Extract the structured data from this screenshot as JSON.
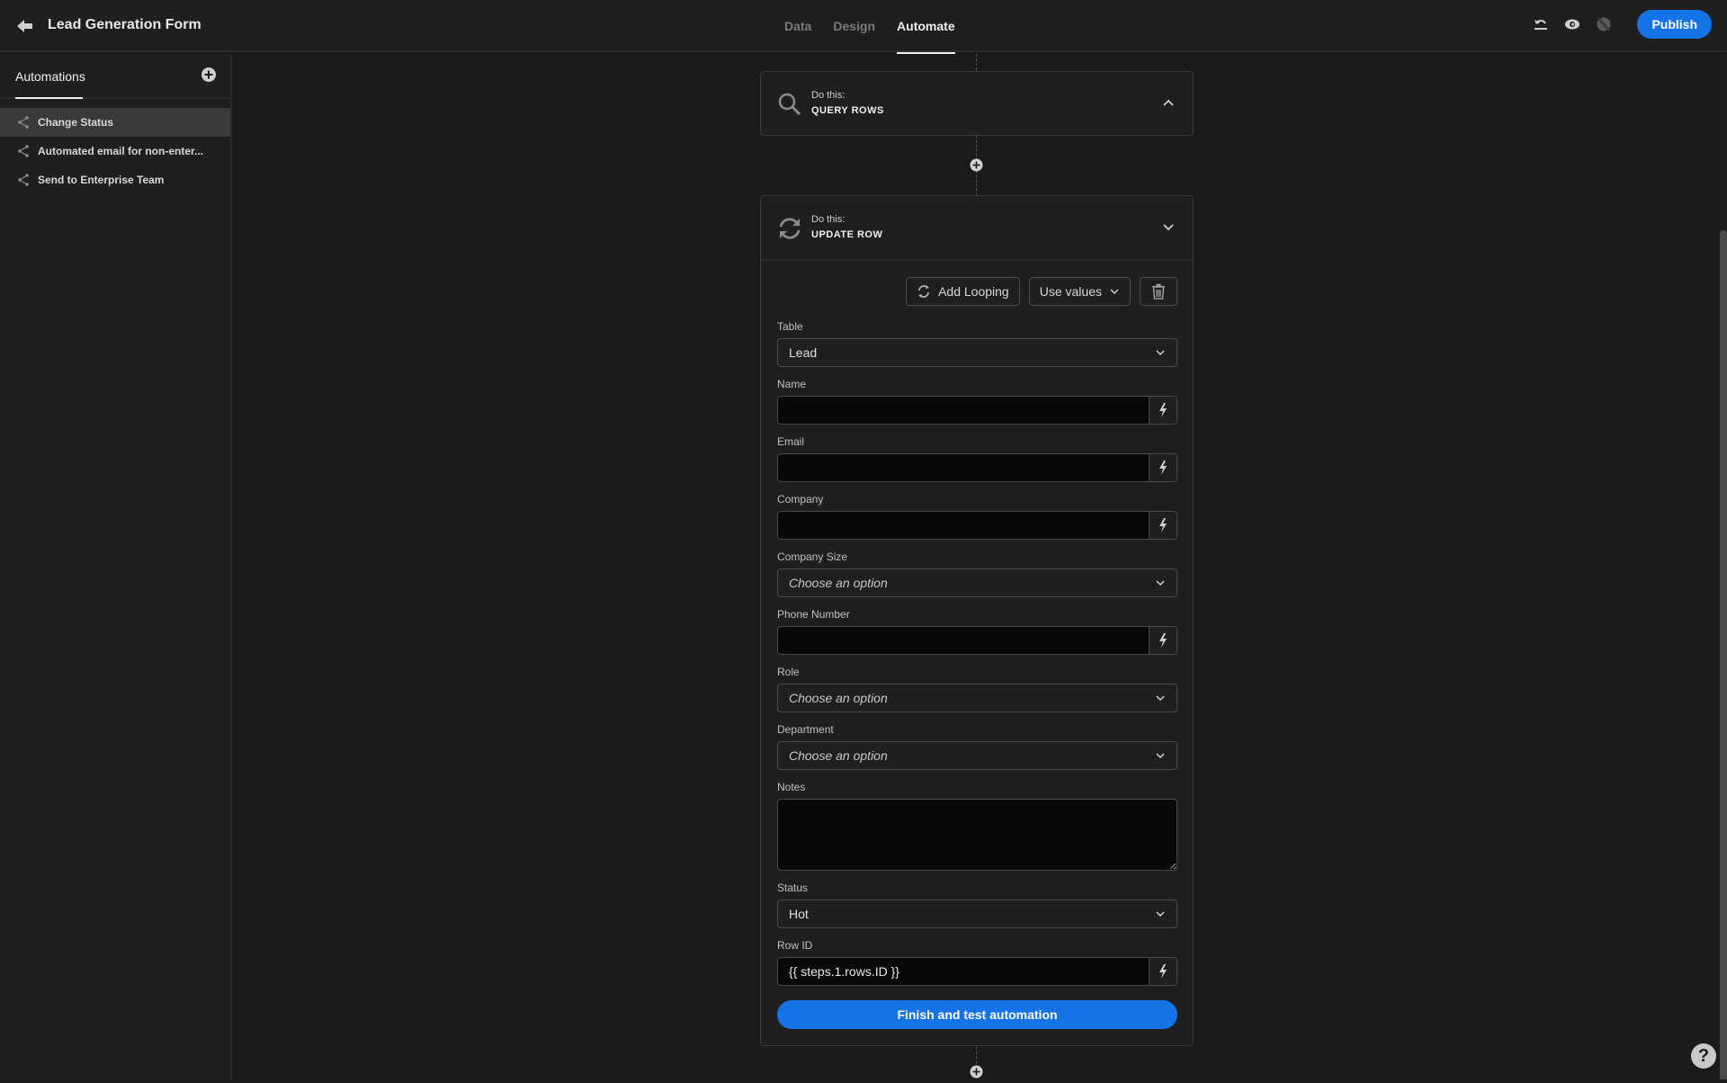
{
  "header": {
    "title": "Lead Generation Form",
    "tabs": [
      {
        "label": "Data",
        "active": false
      },
      {
        "label": "Design",
        "active": false
      },
      {
        "label": "Automate",
        "active": true
      }
    ],
    "publish_label": "Publish",
    "accent": "#1473e6"
  },
  "sidebar": {
    "title": "Automations",
    "items": [
      {
        "label": "Change Status",
        "selected": true
      },
      {
        "label": "Automated email for non-enter..."
      },
      {
        "label": "Send to Enterprise Team"
      }
    ]
  },
  "steps": {
    "query": {
      "label": "Do this:",
      "name": "QUERY ROWS",
      "icon": "search-icon"
    },
    "update": {
      "label": "Do this:",
      "name": "UPDATE ROW",
      "icon": "refresh-icon",
      "actions": {
        "looping": "Add Looping",
        "use_values": "Use values"
      },
      "fields": {
        "table": {
          "label": "Table",
          "value": "Lead"
        },
        "name": {
          "label": "Name",
          "value": ""
        },
        "email": {
          "label": "Email",
          "value": ""
        },
        "company": {
          "label": "Company",
          "value": ""
        },
        "company_size": {
          "label": "Company Size",
          "placeholder": "Choose an option"
        },
        "phone": {
          "label": "Phone Number",
          "value": ""
        },
        "role": {
          "label": "Role",
          "placeholder": "Choose an option"
        },
        "department": {
          "label": "Department",
          "placeholder": "Choose an option"
        },
        "notes": {
          "label": "Notes",
          "value": ""
        },
        "status": {
          "label": "Status",
          "value": "Hot"
        },
        "row_id": {
          "label": "Row ID",
          "value": "{{ steps.1.rows.ID }}"
        }
      },
      "finish_label": "Finish and test automation"
    }
  },
  "help_label": "?"
}
